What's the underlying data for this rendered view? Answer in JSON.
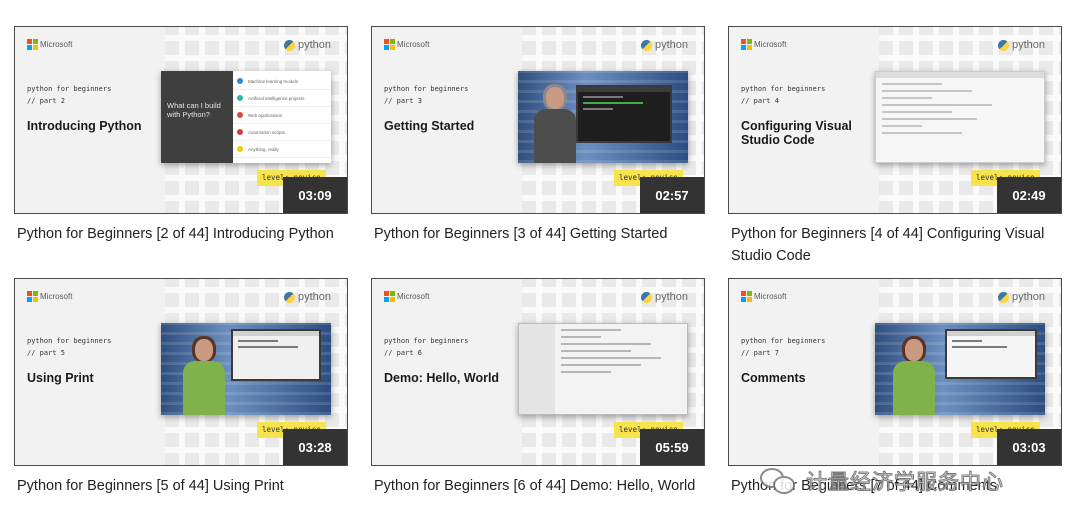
{
  "brand": {
    "microsoft": "Microsoft",
    "python": "python"
  },
  "level_label": "level: novice",
  "watermark_text": "计量经济学服务中心",
  "colors": {
    "level_badge": "#f7e34c",
    "duration_bg": "#333333"
  },
  "videos": [
    {
      "series_line1": "python for beginners",
      "series_line2": "// part 2",
      "episode_title": "Introducing Python",
      "visual_heading": "What can I build with Python?",
      "visual_items": [
        "Machine learning models",
        "Artificial intelligence projects",
        "Web applications",
        "Automation scripts",
        "Anything, really"
      ],
      "duration": "03:09",
      "caption": "Python for Beginners [2 of 44] Introducing Python"
    },
    {
      "series_line1": "python for beginners",
      "series_line2": "// part 3",
      "episode_title": "Getting Started",
      "duration": "02:57",
      "caption": "Python for Beginners [3 of 44] Getting Started"
    },
    {
      "series_line1": "python for beginners",
      "series_line2": "// part 4",
      "episode_title": "Configuring Visual Studio Code",
      "duration": "02:49",
      "caption": "Python for Beginners [4 of 44] Configuring Visual Studio Code"
    },
    {
      "series_line1": "python for beginners",
      "series_line2": "// part 5",
      "episode_title": "Using Print",
      "duration": "03:28",
      "caption": "Python for Beginners [5 of 44] Using Print"
    },
    {
      "series_line1": "python for beginners",
      "series_line2": "// part 6",
      "episode_title": "Demo: Hello, World",
      "duration": "05:59",
      "caption": "Python for Beginners [6 of 44] Demo: Hello, World"
    },
    {
      "series_line1": "python for beginners",
      "series_line2": "// part 7",
      "episode_title": "Comments",
      "duration": "03:03",
      "caption": "Python for Beginners [7 of 44] Comments"
    }
  ]
}
